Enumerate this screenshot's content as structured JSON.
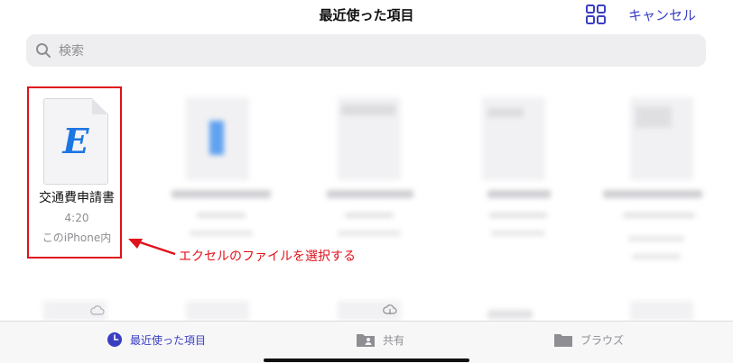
{
  "header": {
    "title": "最近使った項目",
    "cancel_label": "キャンセル",
    "grid_icon": "grid-view-icon"
  },
  "search": {
    "placeholder": "検索",
    "value": "",
    "icon": "magnifier-icon"
  },
  "selected_file": {
    "icon_letter": "E",
    "name": "交通費申請書",
    "time": "4:20",
    "location": "このiPhone内"
  },
  "annotation": {
    "text": "エクセルのファイルを選択する",
    "color": "#e0121b"
  },
  "tabs": [
    {
      "label": "最近使った項目",
      "icon": "clock-icon",
      "active": true
    },
    {
      "label": "共有",
      "icon": "shared-folder-icon",
      "active": false
    },
    {
      "label": "ブラウズ",
      "icon": "folder-icon",
      "active": false
    }
  ],
  "colors": {
    "accent": "#3a3fc2",
    "annotation": "#e0121b",
    "excel_letter": "#1d76e2"
  }
}
